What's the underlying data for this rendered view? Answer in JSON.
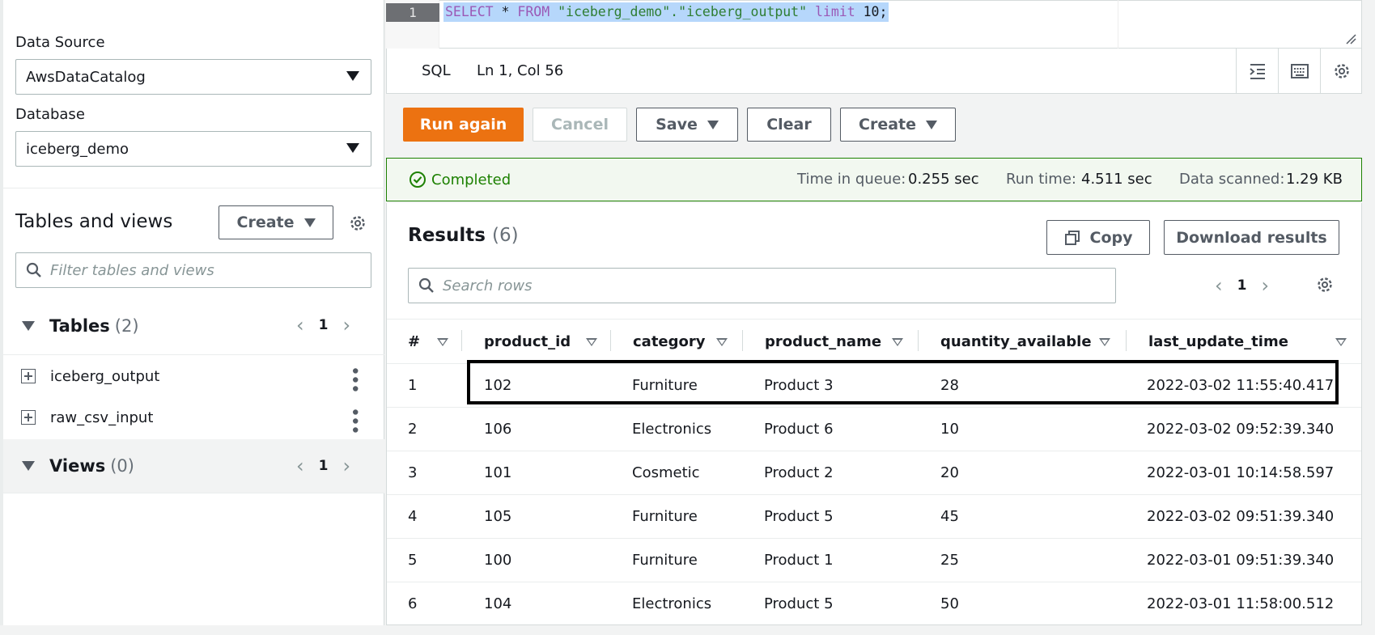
{
  "left": {
    "data_source_label": "Data Source",
    "data_source_value": "AwsDataCatalog",
    "database_label": "Database",
    "database_value": "iceberg_demo",
    "tables_views_title": "Tables and views",
    "create_label": "Create",
    "filter_placeholder": "Filter tables and views",
    "tables_label": "Tables",
    "tables_count": "(2)",
    "tables_page": "1",
    "tables": [
      "iceberg_output",
      "raw_csv_input"
    ],
    "views_label": "Views",
    "views_count": "(0)",
    "views_page": "1"
  },
  "editor": {
    "line_number": "1",
    "query_kw1": "SELECT",
    "query_mid1": " * ",
    "query_kw2": "FROM",
    "query_str": " \"iceberg_demo\".\"iceberg_output\" ",
    "query_kw3": "limit",
    "query_end": " 10;",
    "language": "SQL",
    "cursor_pos": "Ln 1, Col 56"
  },
  "actions": {
    "run_again": "Run again",
    "cancel": "Cancel",
    "save": "Save",
    "clear": "Clear",
    "create": "Create"
  },
  "status": {
    "state": "Completed",
    "queue_label": "Time in queue:",
    "queue_value": "0.255 sec",
    "run_label": "Run time:",
    "run_value": "4.511 sec",
    "scanned_label": "Data scanned:",
    "scanned_value": "1.29 KB",
    "success_color": "#1d8102"
  },
  "results": {
    "title": "Results",
    "count": "(6)",
    "copy_label": "Copy",
    "download_label": "Download results",
    "search_placeholder": "Search rows",
    "page": "1",
    "columns": [
      "#",
      "product_id",
      "category",
      "product_name",
      "quantity_available",
      "last_update_time"
    ],
    "rows": [
      [
        "1",
        "102",
        "Furniture",
        "Product 3",
        "28",
        "2022-03-02 11:55:40.417"
      ],
      [
        "2",
        "106",
        "Electronics",
        "Product 6",
        "10",
        "2022-03-02 09:52:39.340"
      ],
      [
        "3",
        "101",
        "Cosmetic",
        "Product 2",
        "20",
        "2022-03-01 10:14:58.597"
      ],
      [
        "4",
        "105",
        "Furniture",
        "Product 5",
        "45",
        "2022-03-02 09:51:39.340"
      ],
      [
        "5",
        "100",
        "Furniture",
        "Product 1",
        "25",
        "2022-03-01 09:51:39.340"
      ],
      [
        "6",
        "104",
        "Electronics",
        "Product 5",
        "50",
        "2022-03-01 11:58:00.512"
      ]
    ]
  },
  "colors": {
    "accent": "#ec7211",
    "highlight_box": "#000000"
  }
}
